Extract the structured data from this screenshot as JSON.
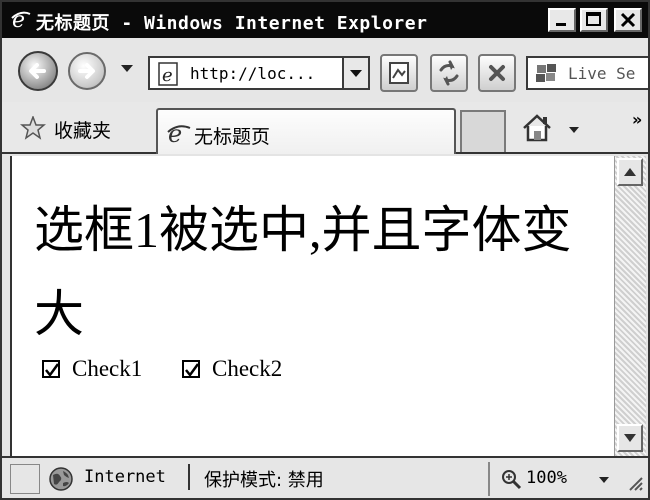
{
  "window": {
    "title": "无标题页 - Windows Internet Explorer"
  },
  "address_bar": {
    "url": "http://loc..."
  },
  "search": {
    "placeholder": "Live Se"
  },
  "favorites": {
    "label": "收藏夹"
  },
  "tabs": [
    {
      "label": "无标题页",
      "active": true
    }
  ],
  "page": {
    "heading": "选框1被选中,并且字体变大",
    "checkboxes": [
      {
        "label": "Check1",
        "checked": true
      },
      {
        "label": "Check2",
        "checked": true
      }
    ]
  },
  "status": {
    "zone": "Internet",
    "protected_mode": "保护模式: 禁用",
    "zoom": "100%"
  },
  "icons": {
    "title": "ie-logo-icon",
    "back": "back-arrow-icon",
    "forward": "forward-arrow-icon",
    "refresh": "refresh-icon",
    "stop": "stop-icon",
    "home": "home-icon",
    "favorites": "star-icon",
    "zone": "globe-icon",
    "zoom": "magnifier-icon"
  },
  "colors": {
    "titlebar": "#0a0a0a",
    "chrome": "#e6e6e6",
    "content": "#ffffff"
  }
}
